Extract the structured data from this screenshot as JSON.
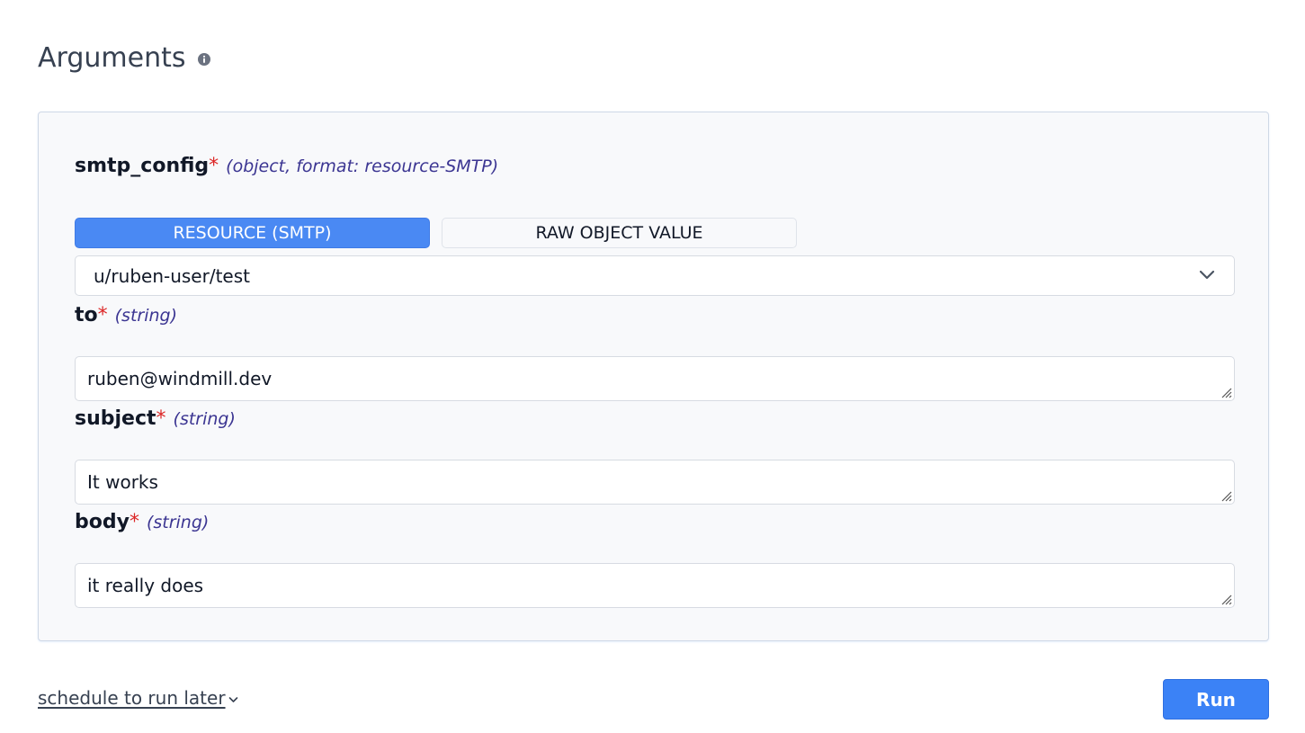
{
  "header": {
    "title": "Arguments",
    "info_icon": "info-icon"
  },
  "colors": {
    "accent": "#4a89f3",
    "run_button": "#3b82f6",
    "required": "#dc2626",
    "type_hint": "#3b3592",
    "panel_bg": "#f8f9fb"
  },
  "fields": {
    "smtp_config": {
      "name": "smtp_config",
      "required_mark": "*",
      "type_hint": "(object, format: resource-SMTP)",
      "toggle": {
        "resource_label": "RESOURCE (SMTP)",
        "raw_label": "RAW OBJECT VALUE",
        "selected": "RESOURCE (SMTP)"
      },
      "selected_resource": "u/ruben-user/test"
    },
    "to": {
      "name": "to",
      "required_mark": "*",
      "type_hint": "(string)",
      "value": "ruben@windmill.dev"
    },
    "subject": {
      "name": "subject",
      "required_mark": "*",
      "type_hint": "(string)",
      "value": "It works"
    },
    "body": {
      "name": "body",
      "required_mark": "*",
      "type_hint": "(string)",
      "value": "it really does"
    }
  },
  "footer": {
    "schedule_label": "schedule to run later",
    "run_label": "Run"
  }
}
